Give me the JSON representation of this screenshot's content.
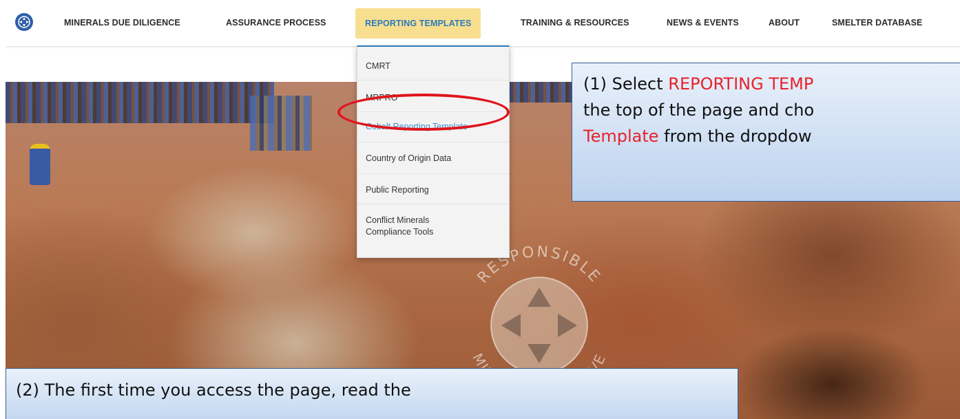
{
  "nav": {
    "items": [
      {
        "label": "MINERALS DUE DILIGENCE"
      },
      {
        "label": "ASSURANCE PROCESS"
      },
      {
        "label": "REPORTING TEMPLATES",
        "active": true
      },
      {
        "label": "TRAINING & RESOURCES"
      },
      {
        "label": "NEWS & EVENTS"
      },
      {
        "label": "ABOUT"
      },
      {
        "label": "SMELTER DATABASE"
      }
    ],
    "active_bg": "#f8df8f",
    "active_color": "#2a7bbd"
  },
  "dropdown": {
    "items": [
      {
        "label": "CMRT"
      },
      {
        "label": "MRPRO"
      },
      {
        "label": "Cobalt Reporting Template",
        "highlighted": true
      },
      {
        "label": "Country of Origin Data"
      },
      {
        "label": "Public Reporting"
      },
      {
        "label_line1": "Conflict Minerals",
        "label_line2": "Compliance Tools"
      }
    ]
  },
  "watermark": {
    "top_text": "RESPONSIBLE",
    "bottom_text": "MINERALS INITIATIVE"
  },
  "callout1": {
    "line1_prefix": "(1) Select ",
    "line1_highlight": "REPORTING TEMP",
    "line2": "the top of the page and cho",
    "line3_highlight": "Template",
    "line3_suffix": " from the dropdow",
    "highlight_color": "#e8222a"
  },
  "callout2": {
    "line1": "(2) The first time you access the page, read the"
  },
  "annotation_color": "#e0151c"
}
